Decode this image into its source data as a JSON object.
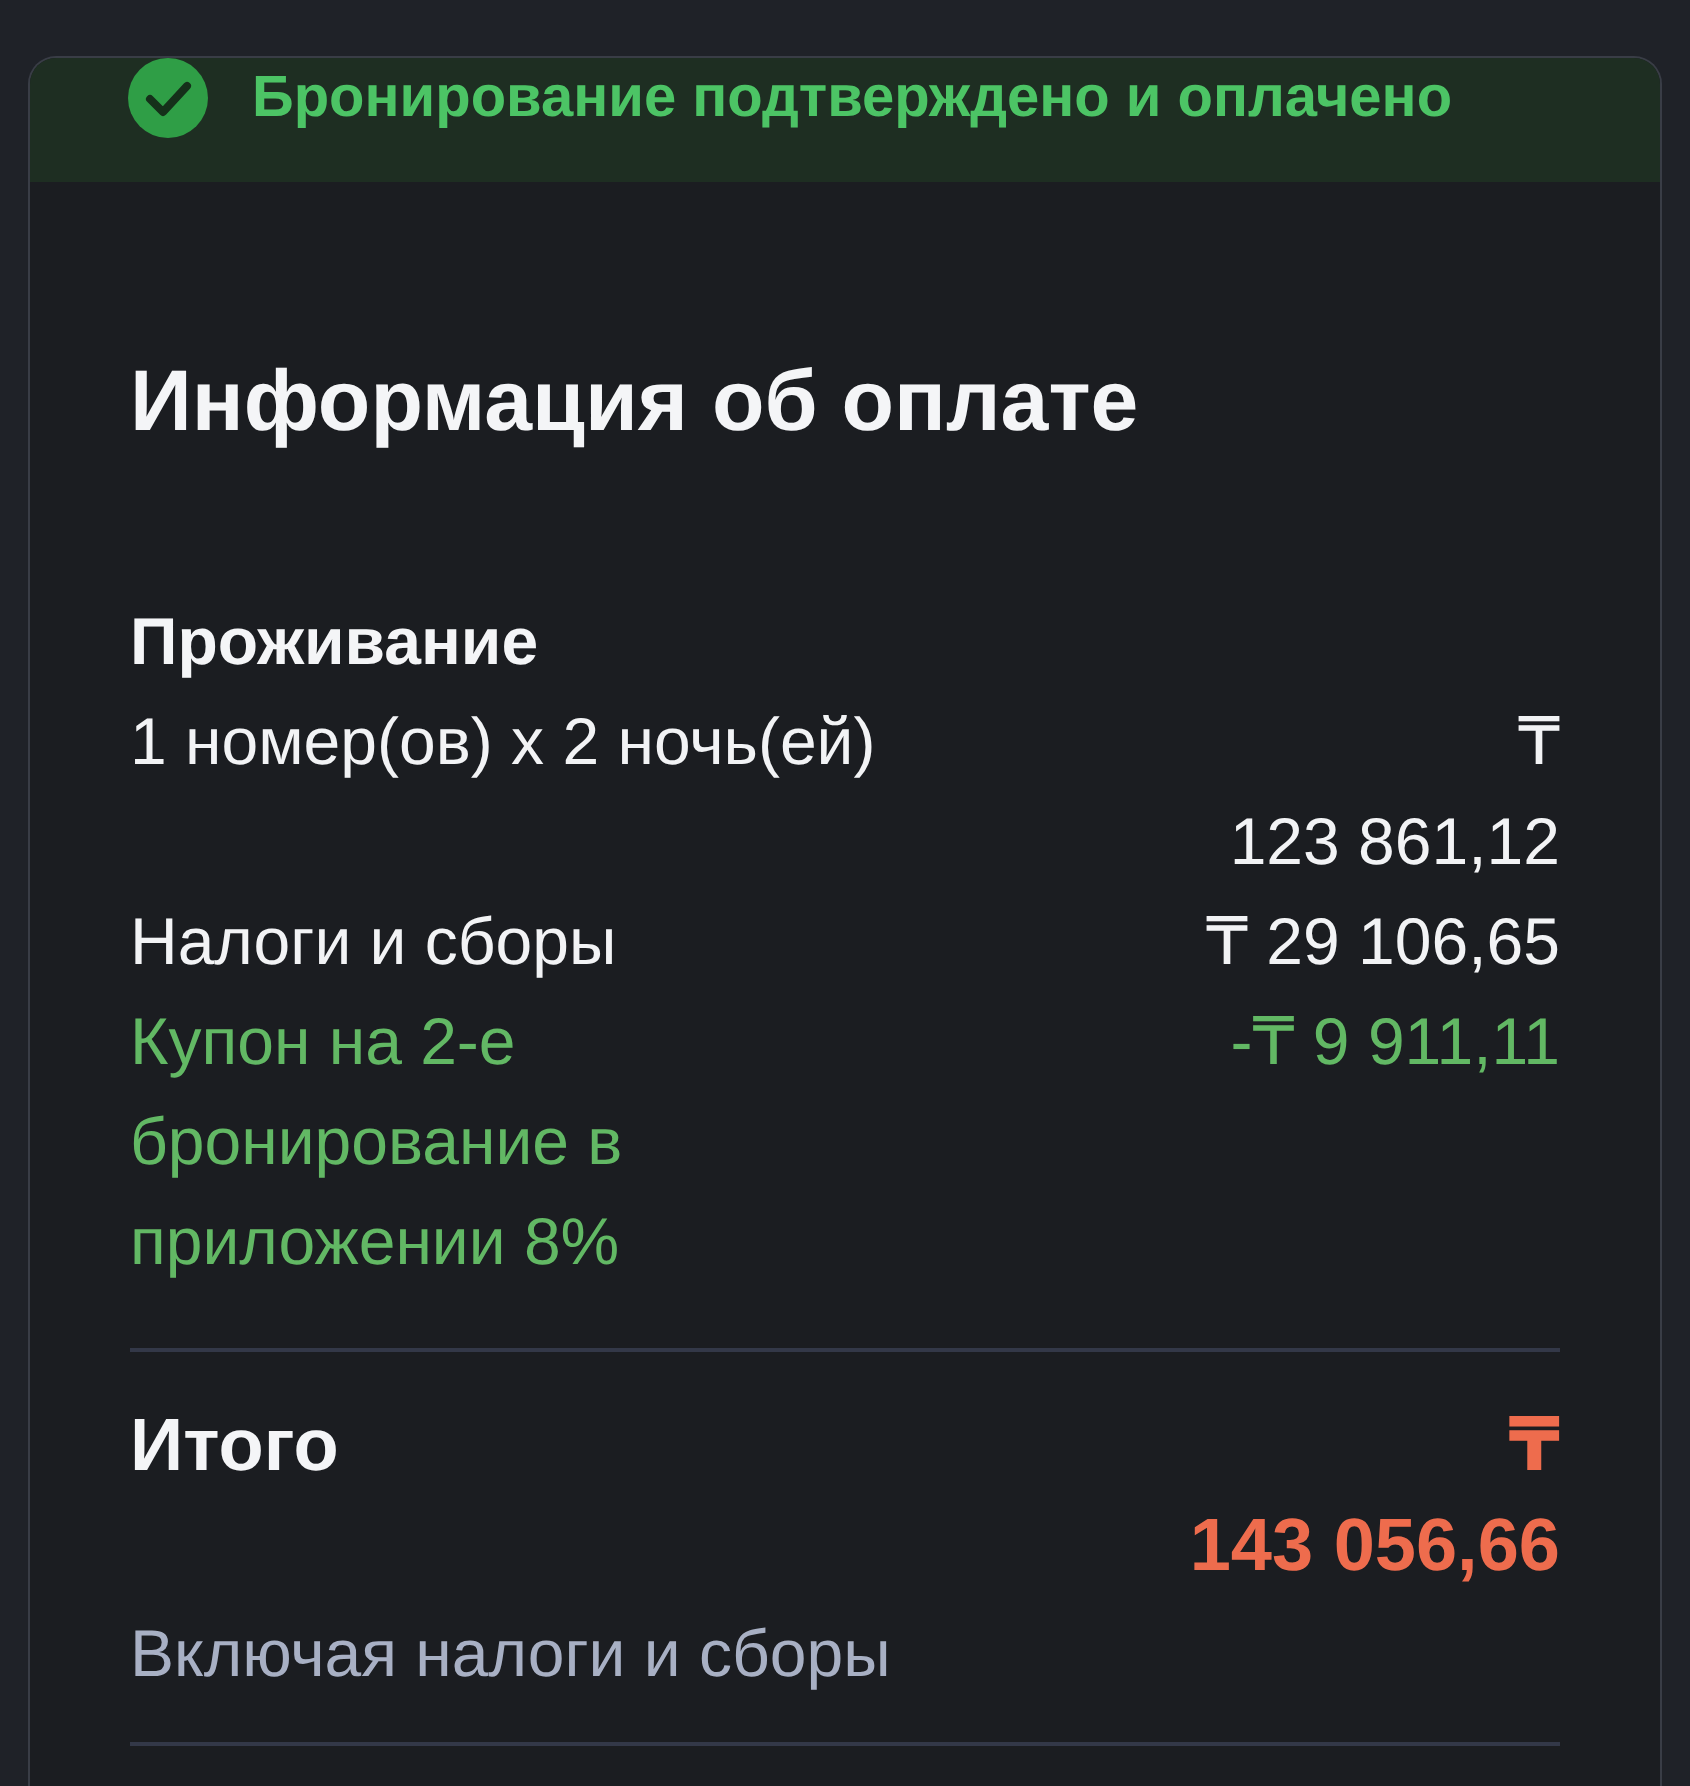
{
  "banner": {
    "kind": "success",
    "text": "Бронирование подтверждено и оплачено"
  },
  "title": "Информация об оплате",
  "section": {
    "title": "Проживание",
    "items": [
      {
        "kind": "charge",
        "label": "1 номер(ов) x 2 ночь(ей)",
        "amount": "₸ 123 861,12"
      },
      {
        "kind": "charge",
        "label": "Налоги и сборы",
        "amount": "₸ 29 106,65"
      },
      {
        "kind": "discount",
        "label": "Купон на 2-е бронирование в приложении 8%",
        "amount": "-₸ 9 911,11"
      }
    ]
  },
  "total": {
    "label": "Итого",
    "amount": "₸ 143 056,66",
    "note": "Включая налоги и сборы"
  }
}
